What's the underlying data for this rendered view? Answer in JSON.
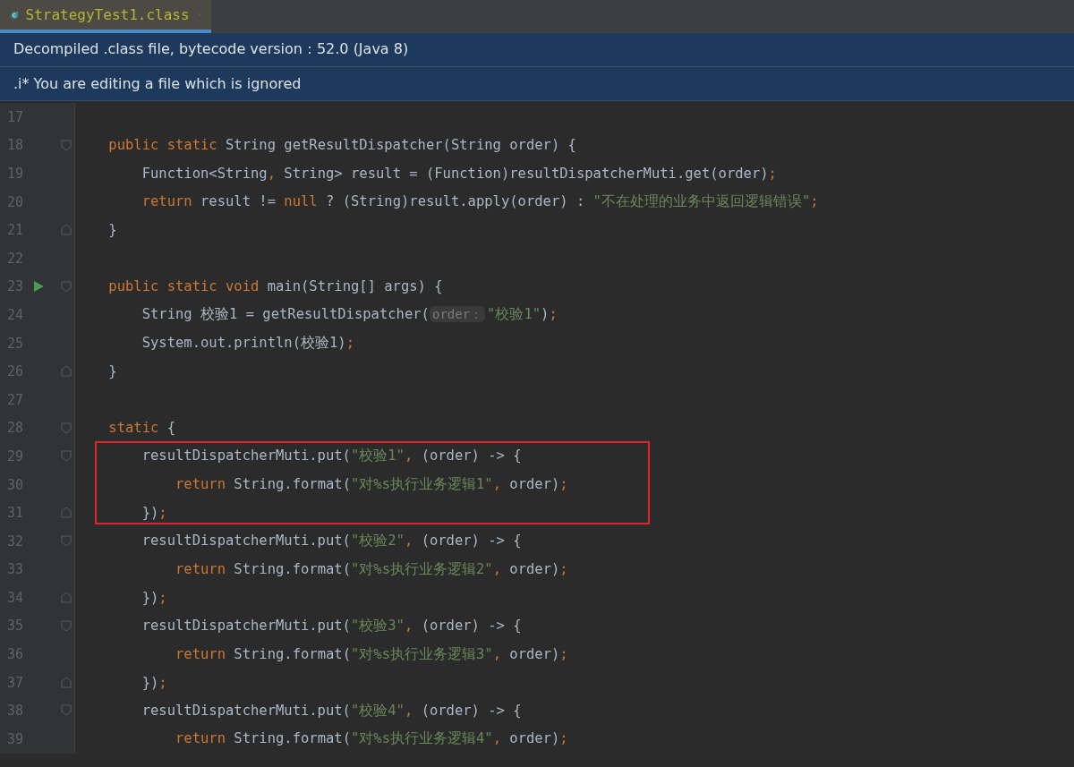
{
  "tab": {
    "label": "StrategyTest1.class",
    "selected": true
  },
  "banners": [
    "Decompiled .class file, bytecode version：52.0 (Java 8)",
    ".i* You are editing a file which is ignored"
  ],
  "lines": [
    {
      "number": "17"
    },
    {
      "number": "18",
      "fold_start": true,
      "tokens": [
        {
          "kind": "kw",
          "text": "    public static "
        },
        {
          "kind": "plain",
          "text": "String getResultDispatcher(String order) {"
        }
      ]
    },
    {
      "number": "19",
      "tokens": [
        {
          "kind": "plain",
          "text": "        Function<String"
        },
        {
          "kind": "punct",
          "text": ", "
        },
        {
          "kind": "plain",
          "text": "String> result = (Function)resultDispatcherMuti.get(order)"
        },
        {
          "kind": "punct",
          "text": ";"
        }
      ]
    },
    {
      "number": "20",
      "tokens": [
        {
          "kind": "kw",
          "text": "        return "
        },
        {
          "kind": "plain",
          "text": "result != "
        },
        {
          "kind": "kw",
          "text": "null "
        },
        {
          "kind": "plain",
          "text": "? (String)result.apply(order) : "
        },
        {
          "kind": "str",
          "text": "\"不在处理的业务中返回逻辑错误\""
        },
        {
          "kind": "punct",
          "text": ";"
        }
      ]
    },
    {
      "number": "21",
      "fold_end": true,
      "tokens": [
        {
          "kind": "plain",
          "text": "    }"
        }
      ]
    },
    {
      "number": "22"
    },
    {
      "number": "23",
      "fold_start": true,
      "run": true,
      "tokens": [
        {
          "kind": "kw",
          "text": "    public static void "
        },
        {
          "kind": "plain",
          "text": "main(String[] args) {"
        }
      ]
    },
    {
      "number": "24",
      "tokens": [
        {
          "kind": "plain",
          "text": "        String 校验1 = getResultDispatcher("
        },
        {
          "kind": "hint",
          "text": "order："
        },
        {
          "kind": "str",
          "text": "\"校验1\""
        },
        {
          "kind": "plain",
          "text": ")"
        },
        {
          "kind": "punct",
          "text": ";"
        }
      ]
    },
    {
      "number": "25",
      "tokens": [
        {
          "kind": "plain",
          "text": "        System.out.println(校验1)"
        },
        {
          "kind": "punct",
          "text": ";"
        }
      ]
    },
    {
      "number": "26",
      "fold_end": true,
      "tokens": [
        {
          "kind": "plain",
          "text": "    }"
        }
      ]
    },
    {
      "number": "27"
    },
    {
      "number": "28",
      "fold_start": true,
      "tokens": [
        {
          "kind": "kw",
          "text": "    static "
        },
        {
          "kind": "plain",
          "text": "{"
        }
      ]
    },
    {
      "number": "29",
      "fold_start": true,
      "highlighted": true,
      "tokens": [
        {
          "kind": "plain",
          "text": "        resultDispatcherMuti.put("
        },
        {
          "kind": "str",
          "text": "\"校验1\""
        },
        {
          "kind": "punct",
          "text": ", "
        },
        {
          "kind": "plain",
          "text": "(order) -> {"
        }
      ]
    },
    {
      "number": "30",
      "highlighted": true,
      "tokens": [
        {
          "kind": "kw",
          "text": "            return "
        },
        {
          "kind": "plain",
          "text": "String.format("
        },
        {
          "kind": "str",
          "text": "\"对%s执行业务逻辑1\""
        },
        {
          "kind": "punct",
          "text": ", "
        },
        {
          "kind": "plain",
          "text": "order)"
        },
        {
          "kind": "punct",
          "text": ";"
        }
      ]
    },
    {
      "number": "31",
      "fold_end": true,
      "highlighted": true,
      "tokens": [
        {
          "kind": "plain",
          "text": "        })"
        },
        {
          "kind": "punct",
          "text": ";"
        }
      ]
    },
    {
      "number": "32",
      "fold_start": true,
      "tokens": [
        {
          "kind": "plain",
          "text": "        resultDispatcherMuti.put("
        },
        {
          "kind": "str",
          "text": "\"校验2\""
        },
        {
          "kind": "punct",
          "text": ", "
        },
        {
          "kind": "plain",
          "text": "(order) -> {"
        }
      ]
    },
    {
      "number": "33",
      "tokens": [
        {
          "kind": "kw",
          "text": "            return "
        },
        {
          "kind": "plain",
          "text": "String.format("
        },
        {
          "kind": "str",
          "text": "\"对%s执行业务逻辑2\""
        },
        {
          "kind": "punct",
          "text": ", "
        },
        {
          "kind": "plain",
          "text": "order)"
        },
        {
          "kind": "punct",
          "text": ";"
        }
      ]
    },
    {
      "number": "34",
      "fold_end": true,
      "tokens": [
        {
          "kind": "plain",
          "text": "        })"
        },
        {
          "kind": "punct",
          "text": ";"
        }
      ]
    },
    {
      "number": "35",
      "fold_start": true,
      "tokens": [
        {
          "kind": "plain",
          "text": "        resultDispatcherMuti.put("
        },
        {
          "kind": "str",
          "text": "\"校验3\""
        },
        {
          "kind": "punct",
          "text": ", "
        },
        {
          "kind": "plain",
          "text": "(order) -> {"
        }
      ]
    },
    {
      "number": "36",
      "tokens": [
        {
          "kind": "kw",
          "text": "            return "
        },
        {
          "kind": "plain",
          "text": "String.format("
        },
        {
          "kind": "str",
          "text": "\"对%s执行业务逻辑3\""
        },
        {
          "kind": "punct",
          "text": ", "
        },
        {
          "kind": "plain",
          "text": "order)"
        },
        {
          "kind": "punct",
          "text": ";"
        }
      ]
    },
    {
      "number": "37",
      "fold_end": true,
      "tokens": [
        {
          "kind": "plain",
          "text": "        })"
        },
        {
          "kind": "punct",
          "text": ";"
        }
      ]
    },
    {
      "number": "38",
      "fold_start": true,
      "tokens": [
        {
          "kind": "plain",
          "text": "        resultDispatcherMuti.put("
        },
        {
          "kind": "str",
          "text": "\"校验4\""
        },
        {
          "kind": "punct",
          "text": ", "
        },
        {
          "kind": "plain",
          "text": "(order) -> {"
        }
      ]
    },
    {
      "number": "39",
      "tokens": [
        {
          "kind": "kw",
          "text": "            return "
        },
        {
          "kind": "plain",
          "text": "String.format("
        },
        {
          "kind": "str",
          "text": "\"对%s执行业务逻辑4\""
        },
        {
          "kind": "punct",
          "text": ", "
        },
        {
          "kind": "plain",
          "text": "order)"
        },
        {
          "kind": "punct",
          "text": ";"
        }
      ]
    }
  ]
}
